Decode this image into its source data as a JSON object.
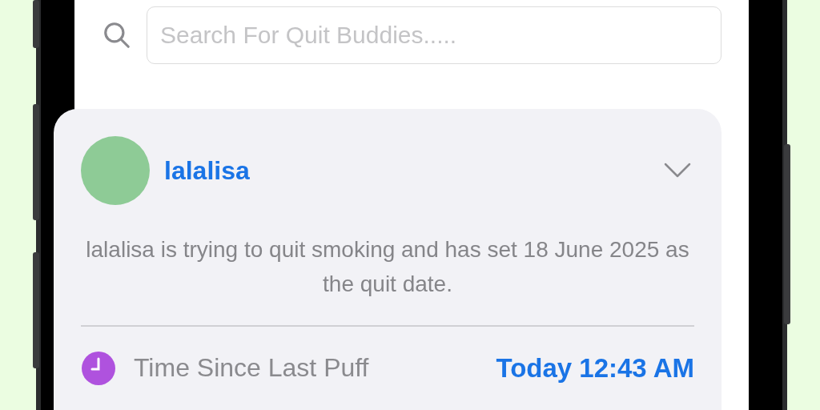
{
  "search": {
    "placeholder": "Search For Quit Buddies....."
  },
  "buddy": {
    "name": "lalalisa",
    "expanded": false,
    "description": "lalalisa is trying to quit smoking and has set 18 June 2025 as the quit date.",
    "stat": {
      "label": "Time Since Last Puff",
      "value": "Today 12:43 AM"
    }
  }
}
